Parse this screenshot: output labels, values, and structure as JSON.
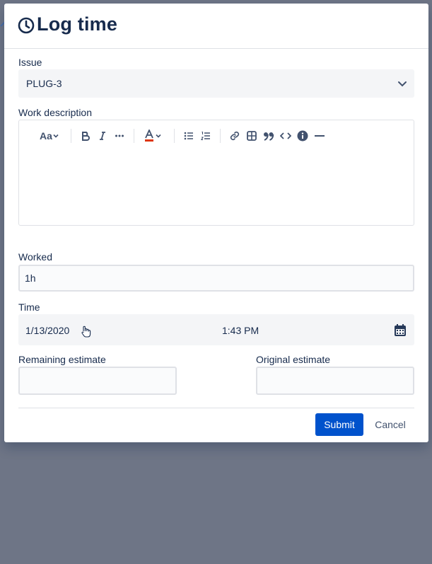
{
  "dialog": {
    "title": "Log time",
    "title_icon": "clock-icon"
  },
  "issue": {
    "label": "Issue",
    "value": "PLUG-3"
  },
  "work_description": {
    "label": "Work description",
    "toolbar": {
      "text_style": "Aa",
      "icons": [
        "text-style-icon",
        "bold-icon",
        "italic-icon",
        "more-formatting-icon",
        "text-color-icon",
        "bullet-list-icon",
        "numbered-list-icon",
        "link-icon",
        "table-icon",
        "quote-icon",
        "code-icon",
        "info-panel-icon",
        "horizontal-rule-icon"
      ]
    }
  },
  "worked": {
    "label": "Worked",
    "value": "1h"
  },
  "time": {
    "label": "Time",
    "date": "1/13/2020",
    "time": "1:43 PM"
  },
  "remaining_estimate": {
    "label": "Remaining estimate",
    "value": ""
  },
  "original_estimate": {
    "label": "Original estimate",
    "value": ""
  },
  "footer": {
    "submit": "Submit",
    "cancel": "Cancel"
  },
  "colors": {
    "primary": "#0052cc",
    "text": "#172b4d",
    "overlay": "#6e7586"
  }
}
